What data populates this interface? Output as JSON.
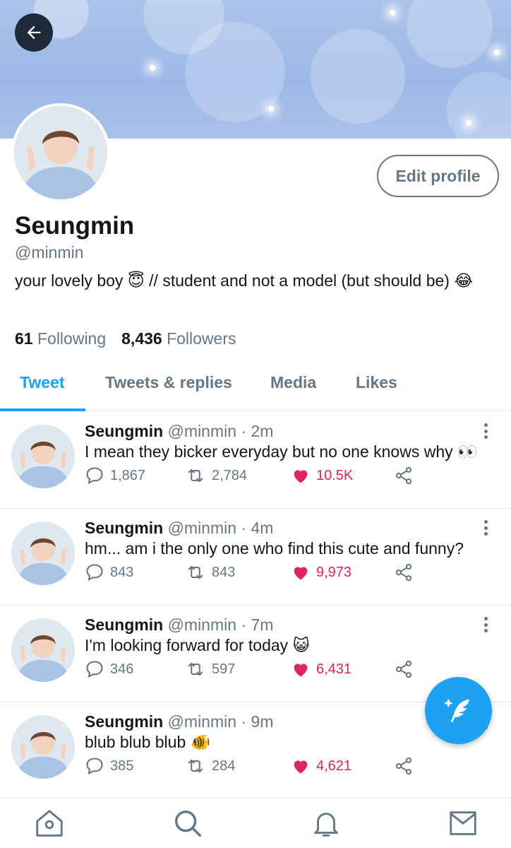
{
  "profile": {
    "name": "Seungmin",
    "handle": "@minmin",
    "bio": "your lovely boy 😇 // student and not a model (but should be) 😂",
    "following_count": "61",
    "following_label": "Following",
    "followers_count": "8,436",
    "followers_label": "Followers",
    "edit_label": "Edit profile"
  },
  "tabs": [
    {
      "label": "Tweet"
    },
    {
      "label": "Tweets & replies"
    },
    {
      "label": "Media"
    },
    {
      "label": "Likes"
    }
  ],
  "tweets": [
    {
      "name": "Seungmin",
      "meta": "@minmin · 2m",
      "text": "I mean they bicker everyday but no one knows why 👀",
      "replies": "1,867",
      "retweets": "2,784",
      "likes": "10.5K"
    },
    {
      "name": "Seungmin",
      "meta": "@minmin · 4m",
      "text": "hm... am i the only one who find this cute and funny?",
      "replies": "843",
      "retweets": "843",
      "likes": "9,973"
    },
    {
      "name": "Seungmin",
      "meta": "@minmin · 7m",
      "text": "I'm looking forward for today 😺",
      "replies": "346",
      "retweets": "597",
      "likes": "6,431"
    },
    {
      "name": "Seungmin",
      "meta": "@minmin · 9m",
      "text": "blub blub blub 🐠",
      "replies": "385",
      "retweets": "284",
      "likes": "4,621"
    }
  ],
  "colors": {
    "accent": "#1da1f2",
    "like": "#e0245e",
    "muted": "#657786",
    "text": "#14171a"
  },
  "icons": {
    "back": "arrow-left-icon",
    "reply": "comment-icon",
    "retweet": "retweet-icon",
    "like": "heart-icon",
    "share": "share-icon",
    "compose": "compose-feather-icon",
    "nav": [
      "home-icon",
      "search-icon",
      "bell-icon",
      "mail-icon"
    ]
  }
}
